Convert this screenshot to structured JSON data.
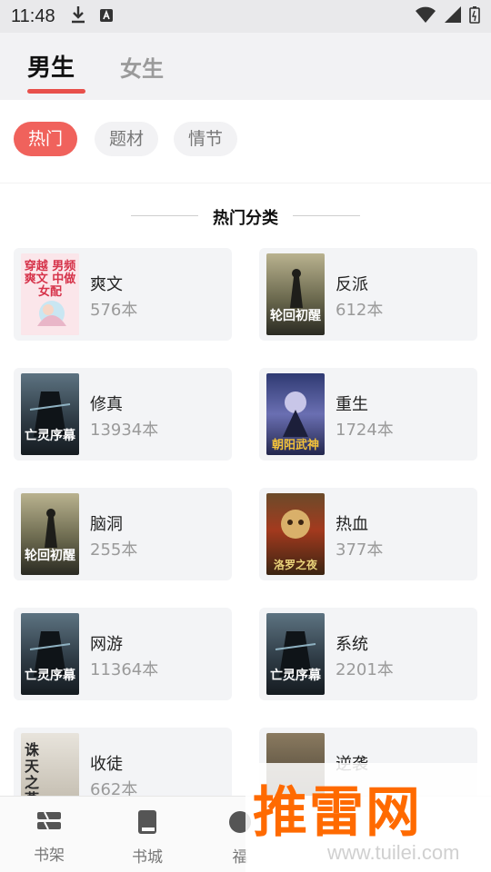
{
  "status_bar": {
    "time": "11:48"
  },
  "gender_tabs": [
    {
      "label": "男生",
      "active": true
    },
    {
      "label": "女生",
      "active": false
    }
  ],
  "filter_chips": [
    {
      "label": "热门",
      "active": true
    },
    {
      "label": "题材",
      "active": false
    },
    {
      "label": "情节",
      "active": false
    }
  ],
  "section_title": "热门分类",
  "categories": [
    {
      "name": "爽文",
      "count": "576本"
    },
    {
      "name": "反派",
      "count": "612本"
    },
    {
      "name": "修真",
      "count": "13934本"
    },
    {
      "name": "重生",
      "count": "1724本"
    },
    {
      "name": "脑洞",
      "count": "255本"
    },
    {
      "name": "热血",
      "count": "377本"
    },
    {
      "name": "网游",
      "count": "11364本"
    },
    {
      "name": "系统",
      "count": "2201本"
    },
    {
      "name": "收徒",
      "count": "662本"
    },
    {
      "name": "逆袭",
      "count": ""
    }
  ],
  "covers": {
    "c1": "穿越 男频爽文 中做女配",
    "c2": "轮回初醒",
    "c3": "亡灵序幕",
    "c4": "朝阳武神",
    "c5": "轮回初醒",
    "c6": "洛罗之夜",
    "c7": "亡灵序幕",
    "c8": "亡灵序幕",
    "c9": "诛天之燕"
  },
  "bottom_nav": [
    {
      "label": "书架",
      "icon": "bookshelf-icon"
    },
    {
      "label": "书城",
      "icon": "book-icon"
    },
    {
      "label": "福",
      "icon": "welfare-icon"
    }
  ],
  "watermark": {
    "logo": "推雷网",
    "url": "www.tuilei.com"
  },
  "colors": {
    "accent": "#f0625c",
    "underline": "#e8504b",
    "card_bg": "#f3f4f6",
    "watermark": "#ff6a00"
  }
}
